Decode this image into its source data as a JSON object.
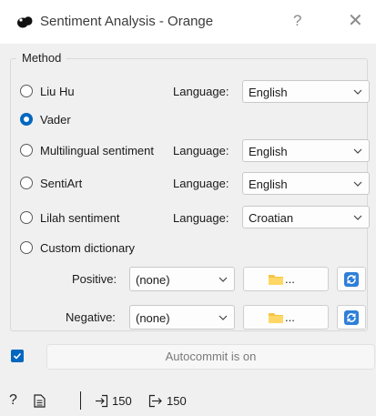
{
  "window": {
    "title": "Sentiment Analysis - Orange",
    "help_glyph": "?",
    "close_glyph": "✕",
    "app_icon": "orange-widget-icon"
  },
  "method": {
    "title": "Method",
    "selected": "Vader",
    "options": [
      {
        "label": "Liu Hu",
        "checked": false,
        "language_label": "Language:",
        "language": "English"
      },
      {
        "label": "Vader",
        "checked": true
      },
      {
        "label": "Multilingual sentiment",
        "checked": false,
        "language_label": "Language:",
        "language": "English"
      },
      {
        "label": "SentiArt",
        "checked": false,
        "language_label": "Language:",
        "language": "English"
      },
      {
        "label": "Lilah sentiment",
        "checked": false,
        "language_label": "Language:",
        "language": "Croatian"
      },
      {
        "label": "Custom dictionary",
        "checked": false
      }
    ],
    "custom": {
      "positive_label": "Positive:",
      "positive_value": "(none)",
      "negative_label": "Negative:",
      "negative_value": "(none)",
      "browse_label": "...",
      "folder_icon": "folder-icon",
      "reload_icon": "reload-icon"
    }
  },
  "autocommit": {
    "checked": true,
    "label": "Autocommit is on"
  },
  "status": {
    "help_glyph": "?",
    "input_count": "150",
    "output_count": "150"
  },
  "colors": {
    "accent": "#0067c0",
    "folder": "#f5c542",
    "reload": "#2f7fd8"
  }
}
